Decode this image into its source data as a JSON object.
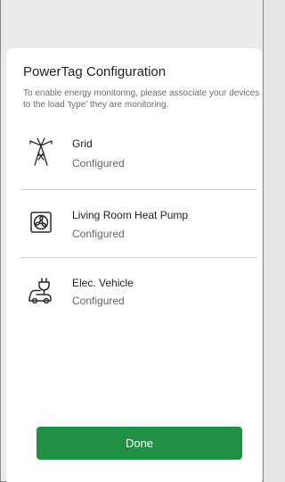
{
  "dialog": {
    "title": "PowerTag Configuration",
    "description": "To enable energy monitoring, please associate your devices to the load 'type' they are monitoring."
  },
  "devices": [
    {
      "name": "Grid",
      "status": "Configured",
      "icon": "grid-tower-icon"
    },
    {
      "name": "Living Room Heat Pump",
      "status": "Configured",
      "icon": "heat-pump-icon"
    },
    {
      "name": "Elec.  Vehicle",
      "status": "Configured",
      "icon": "ev-charger-icon"
    }
  ],
  "footer": {
    "done_label": "Done"
  },
  "colors": {
    "accent": "#219045",
    "text": "#222222",
    "muted": "#666666"
  }
}
